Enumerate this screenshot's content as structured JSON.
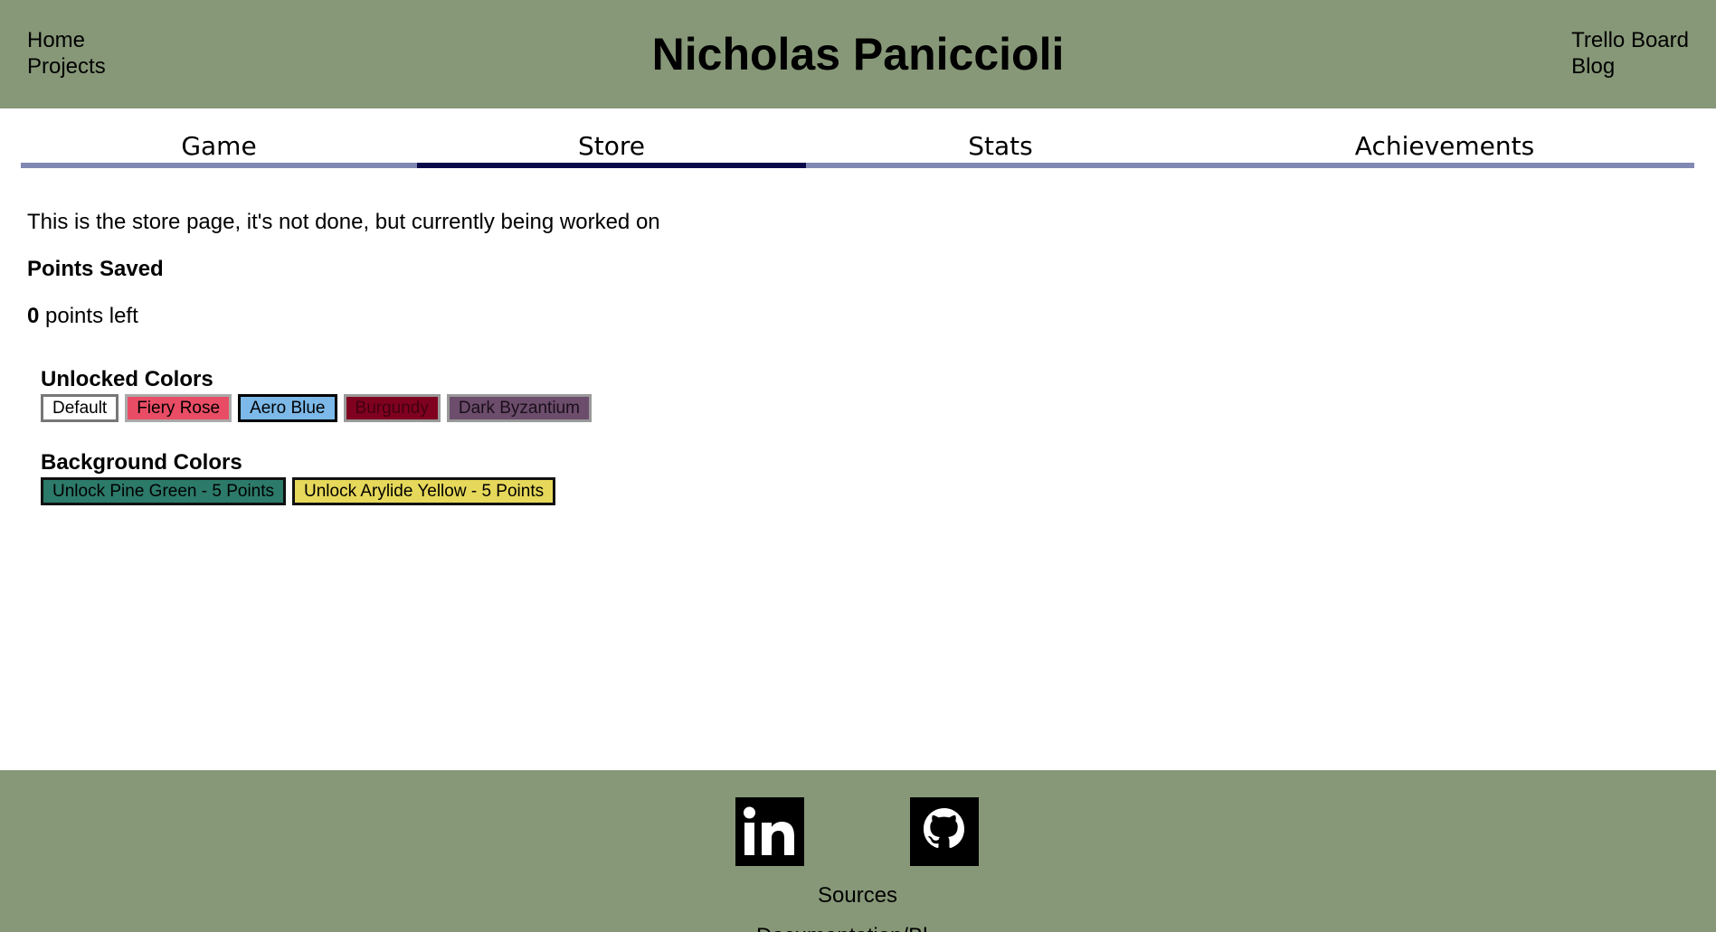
{
  "header": {
    "title": "Nicholas Paniccioli",
    "nav_left": [
      "Home",
      "Projects"
    ],
    "nav_right": [
      "Trello Board",
      "Blog"
    ]
  },
  "tabs": [
    {
      "label": "Game",
      "active": false
    },
    {
      "label": "Store",
      "active": true
    },
    {
      "label": "Stats",
      "active": false
    },
    {
      "label": "Achievements",
      "active": false
    }
  ],
  "store": {
    "intro": "This is the store page, it's not done, but currently being worked on",
    "points_heading": "Points Saved",
    "points_value": "0",
    "points_suffix": " points left",
    "unlocked_colors": {
      "title": "Unlocked Colors",
      "buttons": [
        {
          "label": "Default",
          "color": "#ffffff"
        },
        {
          "label": "Fiery Rose",
          "color": "#e94d65"
        },
        {
          "label": "Aero Blue",
          "color": "#7cb9e8",
          "selected": true
        },
        {
          "label": "Burgundy",
          "color": "#800020"
        },
        {
          "label": "Dark Byzantium",
          "color": "#6c4d6c"
        }
      ]
    },
    "background_colors": {
      "title": "Background Colors",
      "buttons": [
        {
          "label": "Unlock Pine Green - 5 Points",
          "color": "#2c7a6a"
        },
        {
          "label": "Unlock Arylide Yellow - 5 Points",
          "color": "#e6d85a"
        }
      ]
    }
  },
  "footer": {
    "icons": [
      "linkedin-icon",
      "github-icon"
    ],
    "sources": "Sources",
    "docs_partial": "Documentation/Bl"
  },
  "colors": {
    "header_bg": "#879878",
    "tab_underline": "#8088b3",
    "tab_active_underline": "#0a0a4a"
  }
}
